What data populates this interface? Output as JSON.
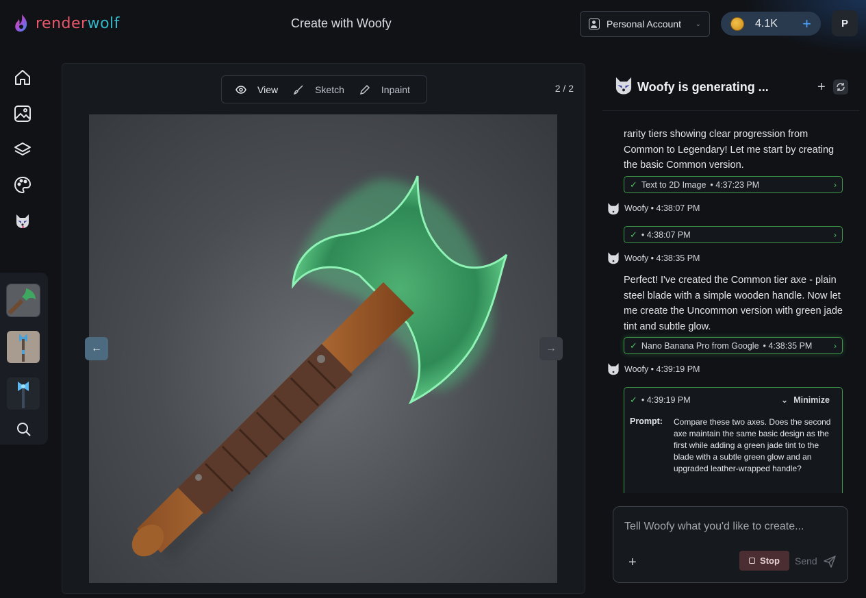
{
  "header": {
    "logo_text_a": "render",
    "logo_text_b": "wolf",
    "title": "Create with Woofy",
    "account_label": "Personal Account",
    "credits": "4.1K",
    "avatar_initial": "P"
  },
  "sidebar": {
    "items": [
      {
        "icon": "home-icon"
      },
      {
        "icon": "image-icon"
      },
      {
        "icon": "layers-icon"
      },
      {
        "icon": "palette-icon"
      },
      {
        "icon": "woofy-icon"
      }
    ],
    "thumbnails": [
      "green-axe",
      "blue-axe-tall",
      "blue-axe-small"
    ],
    "search_icon": "search-icon"
  },
  "canvas": {
    "modes": [
      {
        "label": "View",
        "icon": "eye-icon",
        "active": true
      },
      {
        "label": "Sketch",
        "icon": "brush-icon",
        "active": false
      },
      {
        "label": "Inpaint",
        "icon": "pen-icon",
        "active": false
      }
    ],
    "counter": "2 / 2"
  },
  "chat": {
    "title": "Woofy is generating ...",
    "messages": {
      "intro_text": "rarity tiers showing clear progression from Common to Legendary! Let me start by creating the basic Common version.",
      "tool1_name": "Text to 2D Image",
      "tool1_time": "• 4:37:23 PM",
      "author1": "Woofy • 4:38:07 PM",
      "tool2_time": "• 4:38:07 PM",
      "author2": "Woofy • 4:38:35 PM",
      "text2": "Perfect! I've created the Common tier axe - plain steel blade with a simple wooden handle. Now let me create the Uncommon version with green jade tint and subtle glow.",
      "tool3_name": "Nano Banana Pro from Google",
      "tool3_time": "• 4:38:35 PM",
      "author3": "Woofy • 4:39:19 PM",
      "tool4_time": "• 4:39:19 PM",
      "minimize_label": "Minimize",
      "prompt_label": "Prompt:",
      "prompt_text": "Compare these two axes. Does the second axe maintain the same basic design as the first while adding a green jade tint to the blade with a subtle green glow and an upgraded leather-wrapped handle?"
    },
    "input_placeholder": "Tell Woofy what you'd like to create...",
    "stop_label": "Stop",
    "send_label": "Send"
  },
  "colors": {
    "background": "#101216",
    "accent_green": "#4fc160",
    "accent_blue": "#4da3ff",
    "logo_red": "#e8566c",
    "logo_teal": "#35b7c9"
  }
}
